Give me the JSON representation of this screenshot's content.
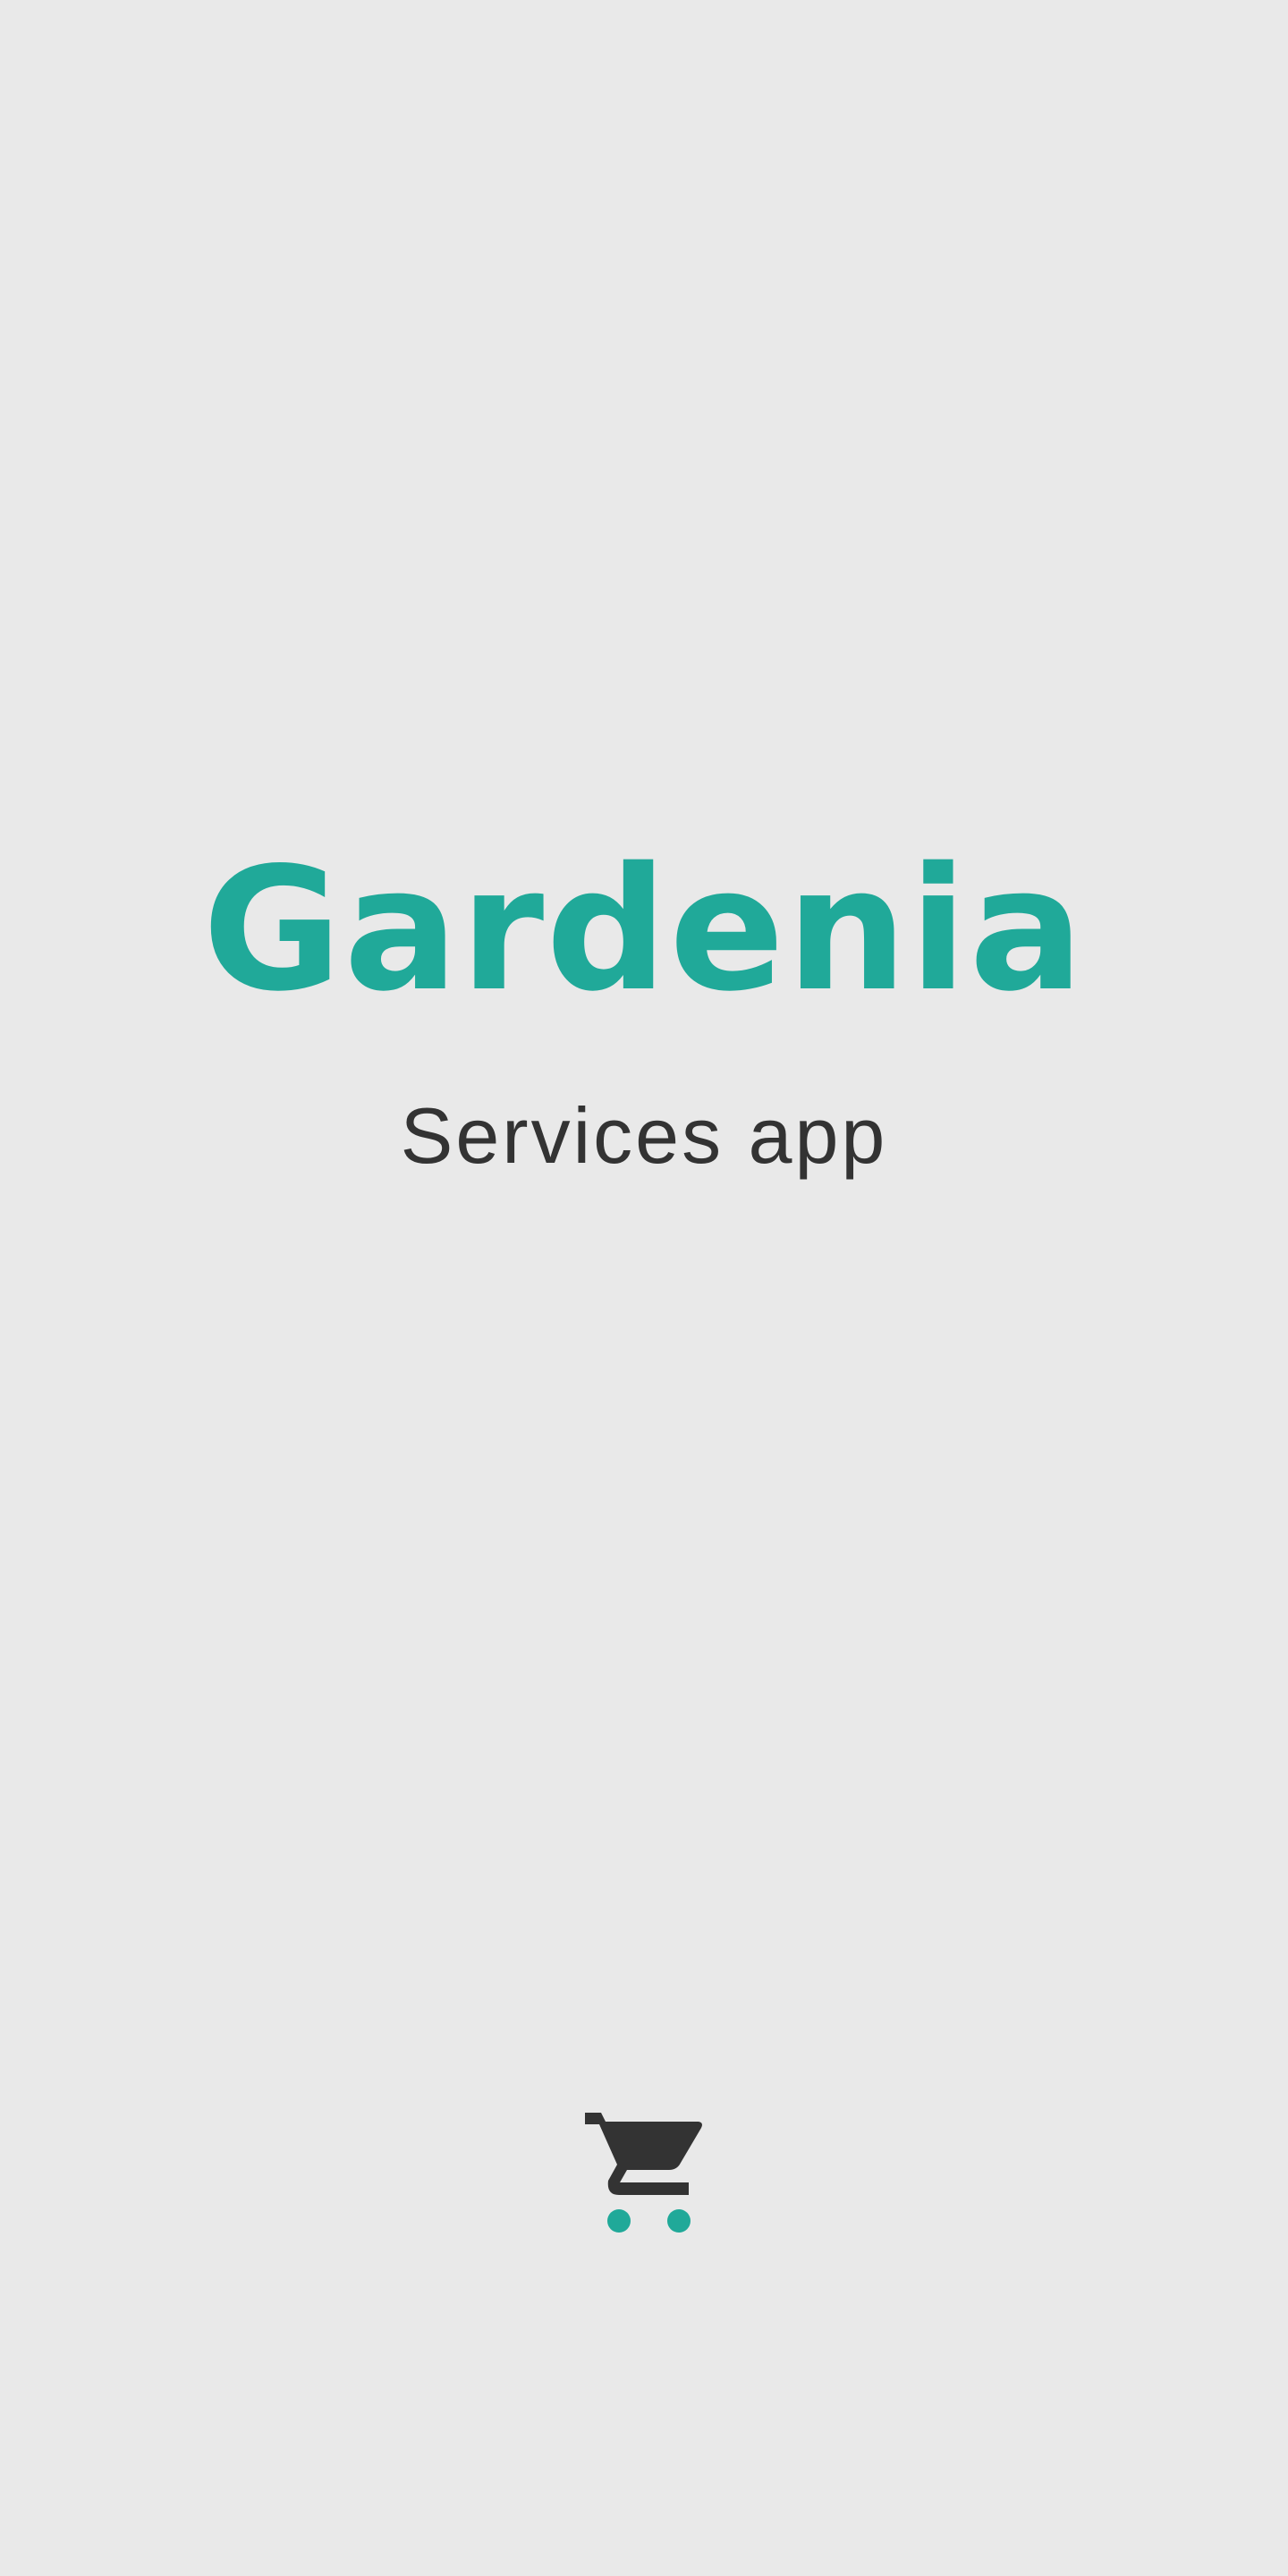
{
  "splash": {
    "title": "Gardenia",
    "subtitle": "Services app"
  },
  "icons": {
    "cart": "shopping-cart-icon"
  },
  "colors": {
    "background": "#e9e9e9",
    "brand": "#20a999",
    "text": "#333333"
  }
}
